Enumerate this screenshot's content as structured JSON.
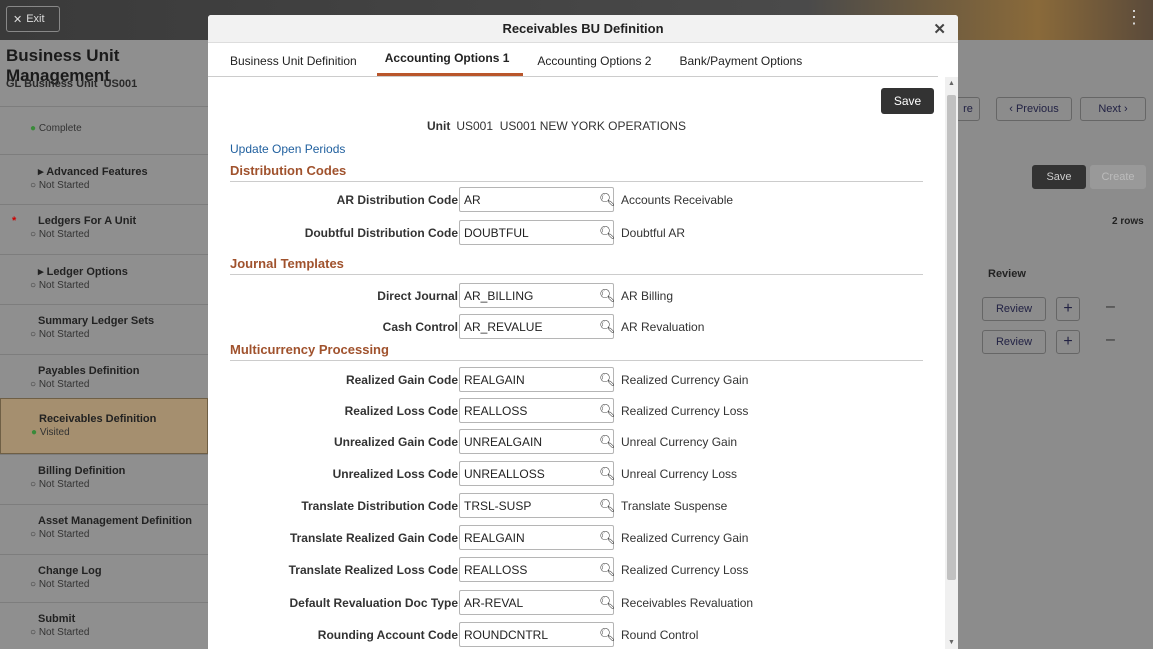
{
  "app": {
    "exit_label": "Exit",
    "title": "Business Unit Management",
    "gl_unit_label": "GL Business Unit",
    "gl_unit_value": "US001"
  },
  "steps": [
    {
      "title": "",
      "status": "Complete"
    },
    {
      "title": "Advanced Features",
      "status": "Not Started"
    },
    {
      "title": "Ledgers For A Unit",
      "status": "Not Started"
    },
    {
      "title": "Ledger Options",
      "status": "Not Started"
    },
    {
      "title": "Summary Ledger Sets",
      "status": "Not Started"
    },
    {
      "title": "Payables Definition",
      "status": "Not Started"
    },
    {
      "title": "Receivables Definition",
      "status": "Visited"
    },
    {
      "title": "Billing Definition",
      "status": "Not Started"
    },
    {
      "title": "Asset Management Definition",
      "status": "Not Started"
    },
    {
      "title": "Change Log",
      "status": "Not Started"
    },
    {
      "title": "Submit",
      "status": "Not Started"
    }
  ],
  "background_right": {
    "more_label": "re",
    "previous_label": "Previous",
    "next_label": "Next",
    "save_label": "Save",
    "create_label": "Create",
    "rows_label": "2 rows",
    "review_header": "Review",
    "review_label": "Review"
  },
  "modal": {
    "title": "Receivables BU Definition",
    "tabs": [
      "Business Unit Definition",
      "Accounting Options 1",
      "Accounting Options 2",
      "Bank/Payment Options"
    ],
    "save_label": "Save",
    "unit_label": "Unit",
    "unit_code": "US001",
    "unit_desc": "US001 NEW YORK OPERATIONS",
    "update_link": "Update Open Periods",
    "sections": [
      "Distribution Codes",
      "Journal Templates",
      "Multicurrency Processing"
    ],
    "fields": [
      {
        "label": "AR Distribution Code",
        "value": "AR",
        "desc": "Accounts Receivable"
      },
      {
        "label": "Doubtful Distribution Code",
        "value": "DOUBTFUL",
        "desc": "Doubtful AR"
      },
      {
        "label": "Direct Journal",
        "value": "AR_BILLING",
        "desc": "AR Billing"
      },
      {
        "label": "Cash Control",
        "value": "AR_REVALUE",
        "desc": "AR Revaluation"
      },
      {
        "label": "Realized Gain Code",
        "value": "REALGAIN",
        "desc": "Realized Currency Gain"
      },
      {
        "label": "Realized Loss Code",
        "value": "REALLOSS",
        "desc": "Realized Currency Loss"
      },
      {
        "label": "Unrealized Gain Code",
        "value": "UNREALGAIN",
        "desc": "Unreal Currency Gain"
      },
      {
        "label": "Unrealized Loss Code",
        "value": "UNREALLOSS",
        "desc": "Unreal Currency Loss"
      },
      {
        "label": "Translate Distribution Code",
        "value": "TRSL-SUSP",
        "desc": "Translate Suspense"
      },
      {
        "label": "Translate Realized Gain Code",
        "value": "REALGAIN",
        "desc": "Realized Currency Gain"
      },
      {
        "label": "Translate Realized Loss Code",
        "value": "REALLOSS",
        "desc": "Realized Currency Loss"
      },
      {
        "label": "Default Revaluation Doc Type",
        "value": "AR-REVAL",
        "desc": "Receivables Revaluation"
      },
      {
        "label": "Rounding Account Code",
        "value": "ROUNDCNTRL",
        "desc": "Round Control"
      }
    ]
  }
}
